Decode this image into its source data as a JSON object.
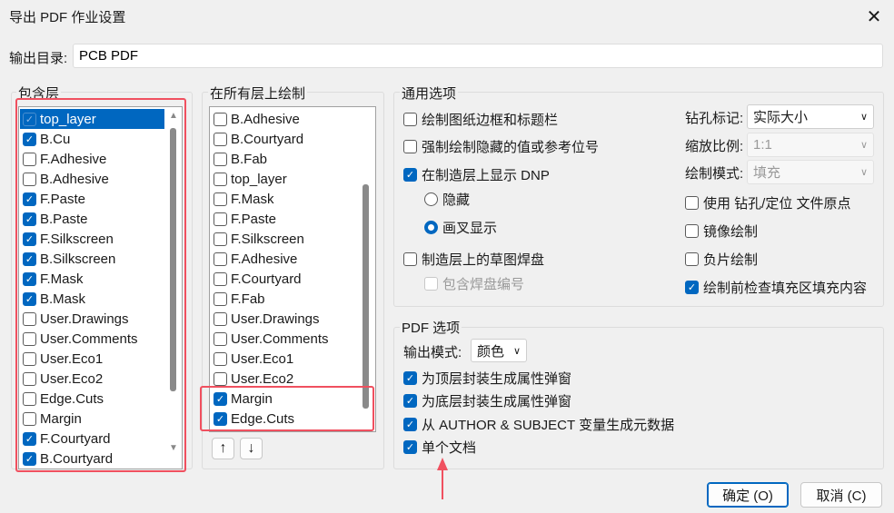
{
  "window": {
    "title": "导出 PDF 作业设置",
    "close_icon": "close-icon"
  },
  "output_dir": {
    "label": "输出目录:",
    "value": "PCB PDF"
  },
  "include_layers": {
    "title": "包含层",
    "items": [
      {
        "label": "top_layer",
        "checked": true,
        "selected": true
      },
      {
        "label": "B.Cu",
        "checked": true
      },
      {
        "label": "F.Adhesive",
        "checked": false
      },
      {
        "label": "B.Adhesive",
        "checked": false
      },
      {
        "label": "F.Paste",
        "checked": true
      },
      {
        "label": "B.Paste",
        "checked": true
      },
      {
        "label": "F.Silkscreen",
        "checked": true
      },
      {
        "label": "B.Silkscreen",
        "checked": true
      },
      {
        "label": "F.Mask",
        "checked": true
      },
      {
        "label": "B.Mask",
        "checked": true
      },
      {
        "label": "User.Drawings",
        "checked": false
      },
      {
        "label": "User.Comments",
        "checked": false
      },
      {
        "label": "User.Eco1",
        "checked": false
      },
      {
        "label": "User.Eco2",
        "checked": false
      },
      {
        "label": "Edge.Cuts",
        "checked": false
      },
      {
        "label": "Margin",
        "checked": false
      },
      {
        "label": "F.Courtyard",
        "checked": true
      },
      {
        "label": "B.Courtyard",
        "checked": true
      }
    ]
  },
  "all_layers": {
    "title": "在所有层上绘制",
    "items": [
      {
        "label": "B.Adhesive",
        "checked": false
      },
      {
        "label": "B.Courtyard",
        "checked": false
      },
      {
        "label": "B.Fab",
        "checked": false
      },
      {
        "label": "top_layer",
        "checked": false
      },
      {
        "label": "F.Mask",
        "checked": false
      },
      {
        "label": "F.Paste",
        "checked": false
      },
      {
        "label": "F.Silkscreen",
        "checked": false
      },
      {
        "label": "F.Adhesive",
        "checked": false
      },
      {
        "label": "F.Courtyard",
        "checked": false
      },
      {
        "label": "F.Fab",
        "checked": false
      },
      {
        "label": "User.Drawings",
        "checked": false
      },
      {
        "label": "User.Comments",
        "checked": false
      },
      {
        "label": "User.Eco1",
        "checked": false
      },
      {
        "label": "User.Eco2",
        "checked": false
      },
      {
        "label": "Margin",
        "checked": true
      },
      {
        "label": "Edge.Cuts",
        "checked": true
      }
    ],
    "move_up_icon": "arrow-up-icon",
    "move_down_icon": "arrow-down-icon"
  },
  "general": {
    "title": "通用选项",
    "plot_frame": {
      "label": "绘制图纸边框和标题栏",
      "checked": false
    },
    "force_hidden": {
      "label": "强制绘制隐藏的值或参考位号",
      "checked": false
    },
    "show_dnp": {
      "label": "在制造层上显示 DNP",
      "checked": true
    },
    "dnp_hide": {
      "label": "隐藏",
      "checked": false
    },
    "dnp_cross": {
      "label": "画叉显示",
      "checked": true
    },
    "sketch_pads": {
      "label": "制造层上的草图焊盘",
      "checked": false
    },
    "pad_numbers": {
      "label": "包含焊盘编号",
      "checked": false,
      "disabled": true
    },
    "drill_marks": {
      "label": "钻孔标记:",
      "value": "实际大小"
    },
    "scale": {
      "label": "缩放比例:",
      "value": "1:1",
      "disabled": true
    },
    "plot_mode": {
      "label": "绘制模式:",
      "value": "填充",
      "disabled": true
    },
    "use_origin": {
      "label": "使用 钻孔/定位 文件原点",
      "checked": false
    },
    "mirror": {
      "label": "镜像绘制",
      "checked": false
    },
    "negative": {
      "label": "负片绘制",
      "checked": false
    },
    "check_zones": {
      "label": "绘制前检查填充区填充内容",
      "checked": true
    }
  },
  "pdf": {
    "title": "PDF 选项",
    "output_mode": {
      "label": "输出模式:",
      "value": "颜色"
    },
    "front_popups": {
      "label": "为顶层封装生成属性弹窗",
      "checked": true
    },
    "back_popups": {
      "label": "为底层封装生成属性弹窗",
      "checked": true
    },
    "metadata": {
      "label": "从 AUTHOR & SUBJECT 变量生成元数据",
      "checked": true
    },
    "single_doc": {
      "label": "单个文档",
      "checked": true
    }
  },
  "buttons": {
    "ok": "确定 (O)",
    "cancel": "取消 (C)"
  },
  "colors": {
    "accent": "#0067c0",
    "highlight": "#f0505f"
  }
}
